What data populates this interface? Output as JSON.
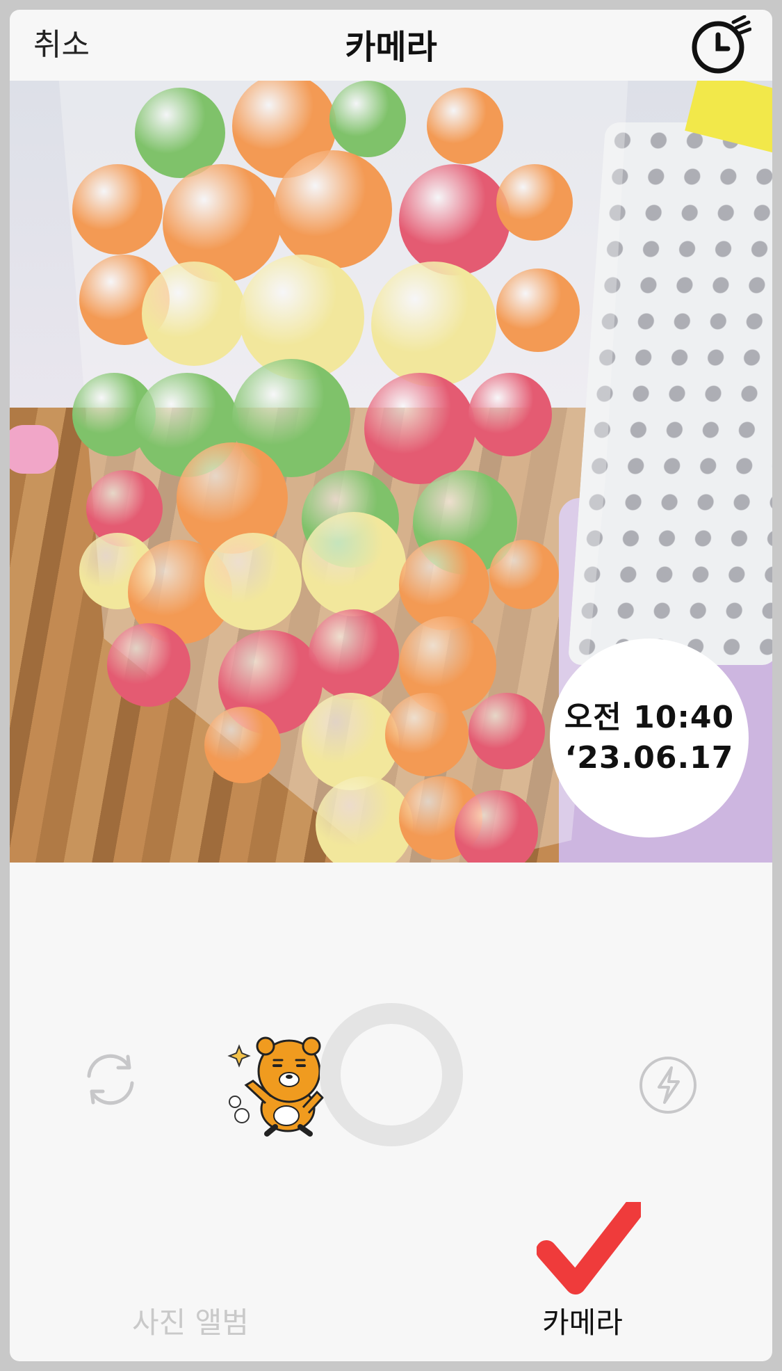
{
  "header": {
    "cancel_label": "취소",
    "title": "카메라",
    "timer_icon": "timer-icon"
  },
  "viewfinder": {
    "timestamp": {
      "time": "오전 10:40",
      "date": "‘23.06.17"
    }
  },
  "controls": {
    "switch_camera_icon": "rotate-camera-icon",
    "sticker_icon": "ryan-character-sticker",
    "shutter_icon": "shutter-button",
    "flash_icon": "flash-icon"
  },
  "tabs": [
    {
      "label": "사진 앨범",
      "selected": false
    },
    {
      "label": "카메라",
      "selected": true
    }
  ],
  "colors": {
    "selected_tab": "#111111",
    "unselected_tab": "#c9c9c9",
    "check_mark": "#ee2a2a",
    "shutter_ring": "#e4e4e4",
    "frame_background": "#f7f7f7"
  }
}
